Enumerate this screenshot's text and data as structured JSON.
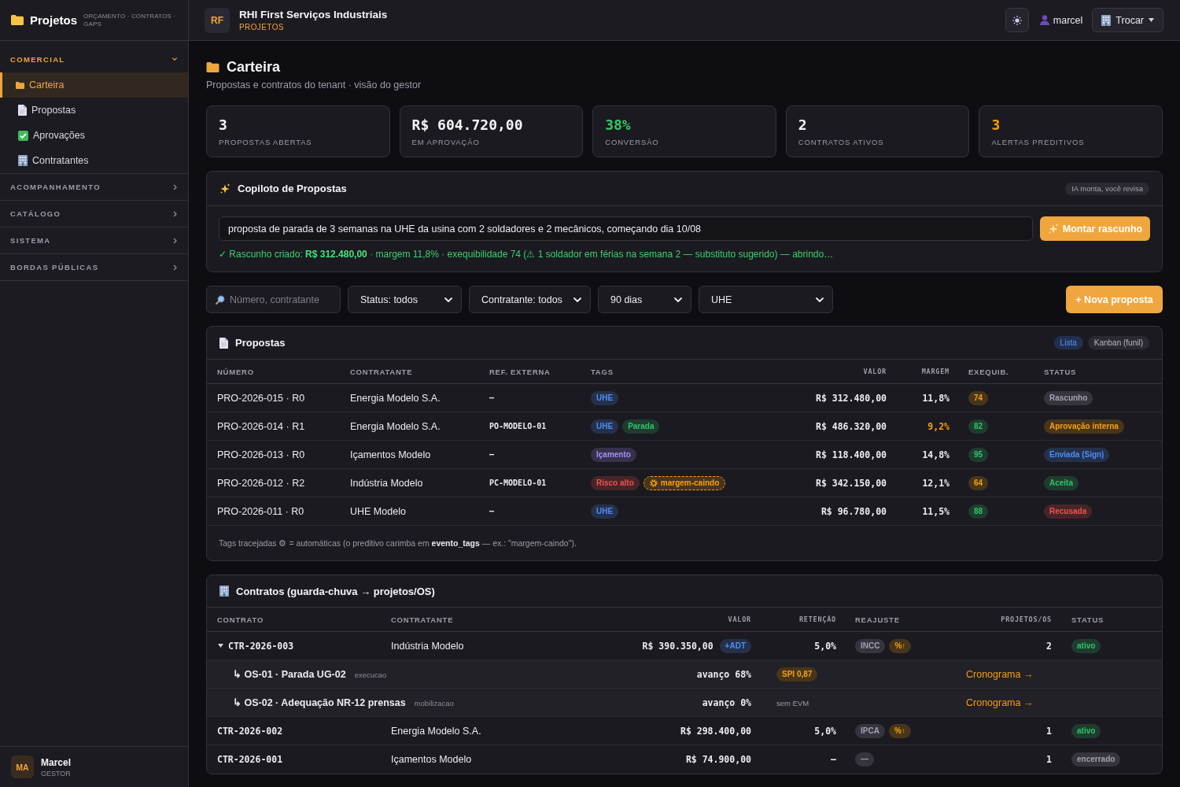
{
  "sidebar": {
    "brand": {
      "title": "Projetos",
      "subtitle": "ORÇAMENTO · CONTRATOS · GAPS"
    },
    "sections": [
      {
        "label": "COMERCIAL",
        "expanded": true,
        "items": [
          {
            "label": "Carteira",
            "selected": true
          },
          {
            "label": "Propostas",
            "selected": false
          },
          {
            "label": "Aprovações",
            "selected": false
          },
          {
            "label": "Contratantes",
            "selected": false
          }
        ]
      },
      {
        "label": "ACOMPANHAMENTO",
        "expanded": false
      },
      {
        "label": "CATÁLOGO",
        "expanded": false
      },
      {
        "label": "SISTEMA",
        "expanded": false
      },
      {
        "label": "BORDAS PÚBLICAS",
        "expanded": false
      }
    ],
    "user": {
      "initials": "MA",
      "name": "Marcel",
      "role": "GESTOR"
    }
  },
  "header": {
    "tenant": {
      "initials": "RF",
      "name": "RHI First Serviços Industriais",
      "module": "PROJETOS"
    },
    "user": "marcel",
    "switch_button": "Trocar"
  },
  "page": {
    "title": "Carteira",
    "subtitle": "Propostas e contratos do tenant · visão do gestor"
  },
  "kpis": [
    {
      "value": "3",
      "label": "PROPOSTAS ABERTAS",
      "color": "#f4f4f7"
    },
    {
      "value": "R$ 604.720,00",
      "label": "EM APROVAÇÃO",
      "color": "#f4f4f7"
    },
    {
      "value": "38%",
      "label": "CONVERSÃO",
      "color": "#34c865"
    },
    {
      "value": "2",
      "label": "CONTRATOS ATIVOS",
      "color": "#f4f4f7"
    },
    {
      "value": "3",
      "label": "ALERTAS PREDITIVOS",
      "color": "#f59f0b"
    }
  ],
  "copilot": {
    "title": "Copiloto de Propostas",
    "badge": "IA monta, você revisa",
    "prompt": "proposta de parada de 3 semanas na UHE da usina com 2 soldadores e 2 mecânicos, começando dia 10/08",
    "button": "Montar rascunho",
    "result": "✓ Rascunho criado: **R$ 312.480,00** · margem 11,8% · exequibilidade 74 (⚠ 1 soldador em férias na semana 2 — substituto sugerido) — abrindo…"
  },
  "filters": {
    "search": {
      "placeholder": "Número, contratante"
    },
    "selects": [
      "Status: todos",
      "Contratante: todos",
      "90 dias",
      "UHE"
    ],
    "new_button": "+ Nova proposta"
  },
  "proposals": {
    "title": "Propostas",
    "views": [
      {
        "label": "Lista",
        "selected": true
      },
      {
        "label": "Kanban (funil)",
        "selected": false
      }
    ],
    "columns": [
      "NÚMERO",
      "CONTRATANTE",
      "REF. EXTERNA",
      "TAGS",
      "VALOR",
      "MARGEM",
      "EXEQUIB.",
      "STATUS"
    ],
    "rows": [
      {
        "numero": "PRO-2026-015 · R0",
        "contratante": "Energia Modelo S.A.",
        "ref": "–",
        "tags": [
          {
            "label": "UHE",
            "color": "#25314b",
            "auto": false
          }
        ],
        "valor": "R$ 312.480,00",
        "margem": "11,8%",
        "margem_low": false,
        "exequib": {
          "label": "74",
          "color": "#47351c"
        },
        "status": {
          "label": "Rascunho",
          "color": "#36353d"
        }
      },
      {
        "numero": "PRO-2026-014 · R1",
        "contratante": "Energia Modelo S.A.",
        "ref": "PO-MODELO-01",
        "tags": [
          {
            "label": "UHE",
            "color": "#25314b",
            "auto": false
          },
          {
            "label": "Parada",
            "color": "#1f3c2f",
            "auto": false
          }
        ],
        "valor": "R$ 486.320,00",
        "margem": "9,2%",
        "margem_low": true,
        "exequib": {
          "label": "82",
          "color": "#1f3c2f"
        },
        "status": {
          "label": "Aprovação interna",
          "color": "#47351c"
        }
      },
      {
        "numero": "PRO-2026-013 · R0",
        "contratante": "Içamentos Modelo",
        "ref": "–",
        "tags": [
          {
            "label": "Içamento",
            "color": "#37314c",
            "auto": false
          }
        ],
        "valor": "R$ 118.400,00",
        "margem": "14,8%",
        "margem_low": false,
        "exequib": {
          "label": "95",
          "color": "#1f3c2f"
        },
        "status": {
          "label": "Enviada (Sign)",
          "color": "#25314b"
        }
      },
      {
        "numero": "PRO-2026-012 · R2",
        "contratante": "Indústria Modelo",
        "ref": "PC-MODELO-01",
        "tags": [
          {
            "label": "Risco alto",
            "color": "#462529",
            "auto": false
          },
          {
            "label": "margem-caindo",
            "color": "#47351c",
            "auto": true
          }
        ],
        "valor": "R$ 342.150,00",
        "margem": "12,1%",
        "margem_low": false,
        "exequib": {
          "label": "64",
          "color": "#47351c"
        },
        "status": {
          "label": "Aceita",
          "color": "#1f3c2f"
        }
      },
      {
        "numero": "PRO-2026-011 · R0",
        "contratante": "UHE Modelo",
        "ref": "–",
        "tags": [
          {
            "label": "UHE",
            "color": "#25314b",
            "auto": false
          }
        ],
        "valor": "R$ 96.780,00",
        "margem": "11,5%",
        "margem_low": false,
        "exequib": {
          "label": "88",
          "color": "#1f3c2f"
        },
        "status": {
          "label": "Recusada",
          "color": "#462529"
        }
      }
    ],
    "note": "Tags tracejadas ⚙ = automáticas (o preditivo carimba em **evento_tags** — ex.: \"margem-caindo\")."
  },
  "contracts": {
    "title": "Contratos (guarda-chuva → projetos/OS)",
    "columns": [
      "CONTRATO",
      "CONTRATANTE",
      "VALOR",
      "RETENÇÃO",
      "REAJUSTE",
      "PROJETOS/OS",
      "STATUS"
    ],
    "rows": [
      {
        "contrato": "CTR-2026-003",
        "expanded": true,
        "contratante": "Indústria Modelo",
        "valor": "R$ 390.350,00",
        "valor_tags": [
          {
            "label": "+ADT",
            "color": "#25314b"
          }
        ],
        "retencao": "5,0%",
        "reajuste": [
          {
            "label": "INCC",
            "color": "#36353d"
          },
          {
            "label": "%↑",
            "color": "#47351c"
          }
        ],
        "projetos": "2",
        "status": {
          "label": "ativo",
          "color": "#1f3c2f"
        },
        "children": [
          {
            "title": "↳ OS-01 · Parada UG-02",
            "phase": "execucao",
            "progress": "avanço 68%",
            "evm": {
              "kind": "badge",
              "label": "SPI 0,87",
              "color": "#47351c"
            },
            "link": "Cronograma →"
          },
          {
            "title": "↳ OS-02 · Adequação NR-12 prensas",
            "phase": "mobilizacao",
            "progress": "avanço 0%",
            "evm": {
              "kind": "note",
              "label": "sem EVM"
            },
            "link": "Cronograma →"
          }
        ]
      },
      {
        "contrato": "CTR-2026-002",
        "contratante": "Energia Modelo S.A.",
        "valor": "R$ 298.400,00",
        "retencao": "5,0%",
        "reajuste": [
          {
            "label": "IPCA",
            "color": "#36353d"
          },
          {
            "label": "%↑",
            "color": "#47351c"
          }
        ],
        "projetos": "1",
        "status": {
          "label": "ativo",
          "color": "#1f3c2f"
        }
      },
      {
        "contrato": "CTR-2026-001",
        "contratante": "Içamentos Modelo",
        "valor": "R$ 74.900,00",
        "retencao": "–",
        "reajuste": [
          {
            "label": "—",
            "color": "#36353d"
          }
        ],
        "projetos": "1",
        "status": {
          "label": "encerrado",
          "color": "#36353d"
        }
      }
    ]
  }
}
